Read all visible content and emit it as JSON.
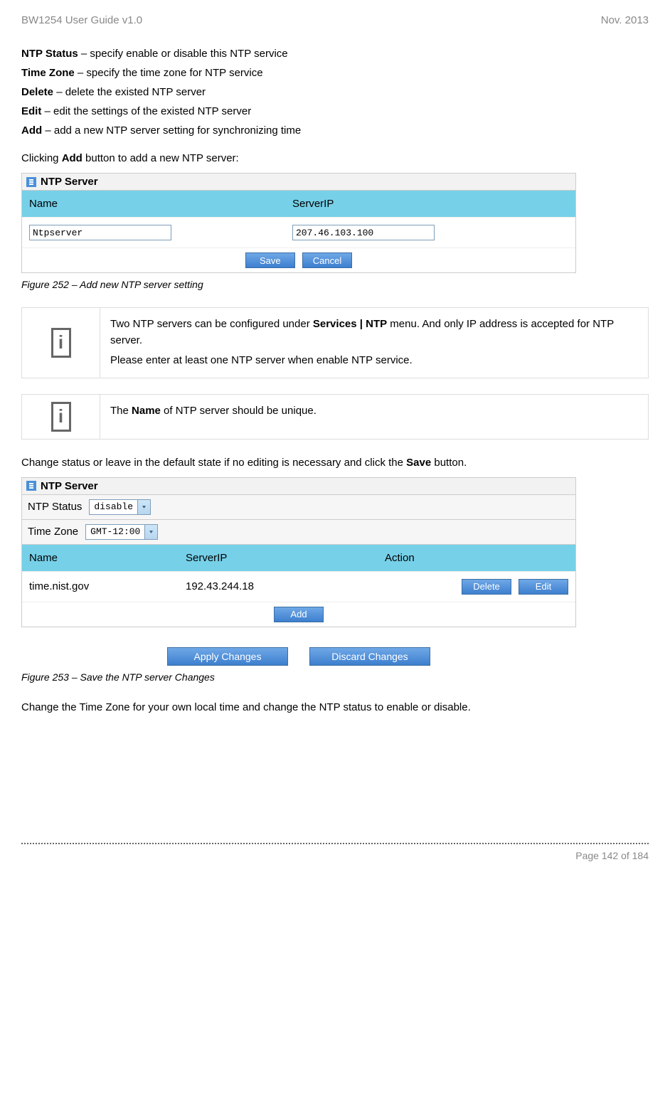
{
  "header": {
    "left": "BW1254 User Guide v1.0",
    "right": "Nov.  2013"
  },
  "terms": {
    "ntp_status_label": "NTP Status",
    "ntp_status_desc": " – specify enable or disable this NTP service",
    "time_zone_label": "Time Zone",
    "time_zone_desc": " – specify the time zone for NTP service",
    "delete_label": "Delete",
    "delete_desc": " – delete the existed NTP server",
    "edit_label": "Edit",
    "edit_desc": " – edit the settings of the existed NTP server",
    "add_label": "Add",
    "add_desc": " – add a new NTP server setting for synchronizing time"
  },
  "para1_pre": "Clicking ",
  "para1_bold": "Add",
  "para1_post": " button to add a new NTP server:",
  "panel1": {
    "title": "NTP Server",
    "col_name": "Name",
    "col_ip": "ServerIP",
    "val_name": "Ntpserver",
    "val_ip": "207.46.103.100",
    "btn_save": "Save",
    "btn_cancel": "Cancel"
  },
  "caption1": "Figure 252 – Add new NTP server setting",
  "info1_pre": "Two NTP servers can be configured under ",
  "info1_bold": "Services | NTP",
  "info1_post": " menu. And only IP address is accepted for NTP server.",
  "info1_line2": "Please enter at least one NTP server when enable NTP service.",
  "info2_pre": "The ",
  "info2_bold": "Name",
  "info2_post": " of NTP server should be unique.",
  "para2_pre": "Change status or leave in the default state if no editing is necessary and click the ",
  "para2_bold": "Save",
  "para2_post": " button.",
  "panel2": {
    "title": "NTP Server",
    "status_label": "NTP Status",
    "status_value": "disable",
    "tz_label": "Time Zone",
    "tz_value": "GMT-12:00",
    "col_name": "Name",
    "col_ip": "ServerIP",
    "col_action": "Action",
    "val_name": "time.nist.gov",
    "val_ip": "192.43.244.18",
    "btn_delete": "Delete",
    "btn_edit": "Edit",
    "btn_add": "Add",
    "btn_apply": "Apply Changes",
    "btn_discard": "Discard Changes"
  },
  "caption2": "Figure 253 – Save the NTP server Changes",
  "para3": "Change the Time Zone for your own local time and change the NTP status to enable or disable.",
  "footer": "Page 142 of 184"
}
